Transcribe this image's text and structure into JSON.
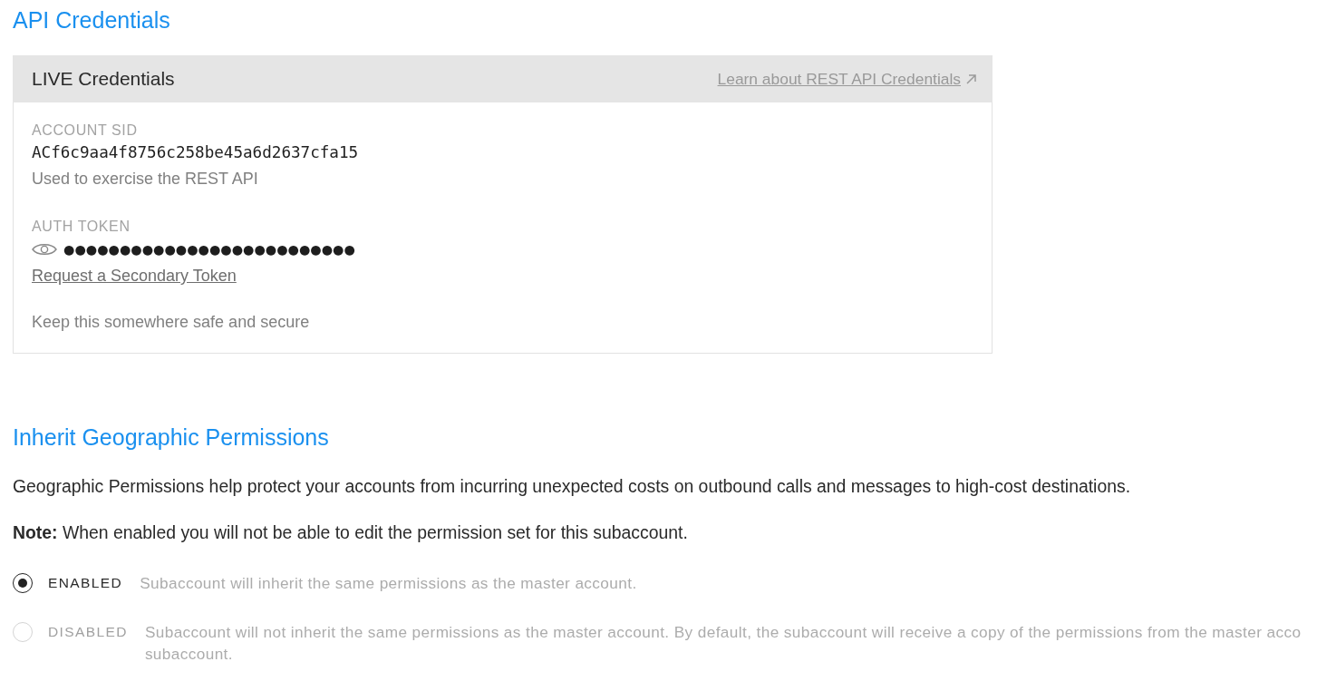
{
  "api_credentials": {
    "title": "API Credentials",
    "card": {
      "title": "LIVE Credentials",
      "link": "Learn about REST API Credentials",
      "account_sid": {
        "label": "ACCOUNT SID",
        "value": "ACf6c9aa4f8756c258be45a6d2637cfa15",
        "help": "Used to exercise the REST API"
      },
      "auth_token": {
        "label": "AUTH TOKEN",
        "masked_value": "●●●●●●●●●●●●●●●●●●●●●●●●●●",
        "link": "Request a Secondary Token",
        "help": "Keep this somewhere safe and secure"
      }
    }
  },
  "geographic_permissions": {
    "title": "Inherit Geographic Permissions",
    "description": "Geographic Permissions help protect your accounts from incurring unexpected costs on outbound calls and messages to high-cost destinations.",
    "note": "**Note:** When enabled you will not be able to edit the permission set for this subaccount.",
    "options": [
      {
        "label": "ENABLED",
        "selected": true,
        "description": [
          "Subaccount will inherit the same permissions as the master account."
        ]
      },
      {
        "label": "DISABLED",
        "selected": false,
        "description": [
          "Subaccount will not inherit the same permissions as the master account. By default, the subaccount will receive a copy of the permissions from the master acco",
          "subaccount."
        ]
      }
    ]
  }
}
